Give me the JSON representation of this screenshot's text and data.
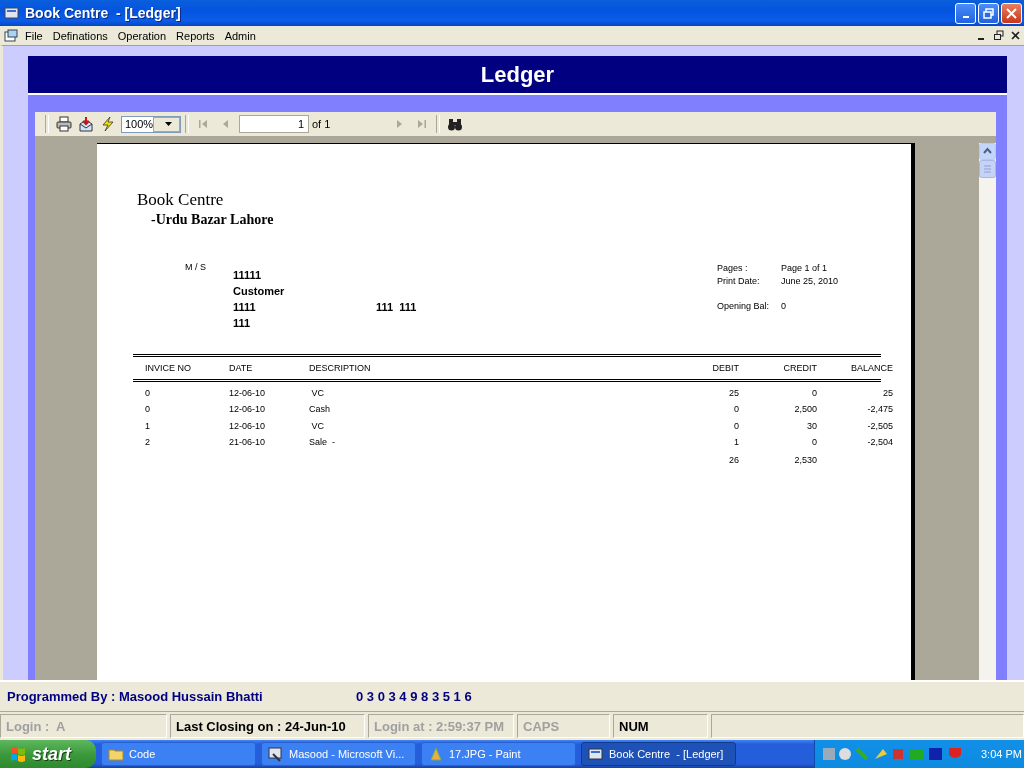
{
  "window": {
    "title": "Book Centre  - [Ledger]"
  },
  "menu": [
    "File",
    "Definations",
    "Operation",
    "Reports",
    "Admin"
  ],
  "report_header": "Ledger",
  "viewer": {
    "zoom": "100%",
    "page": "1",
    "page_of": "of 1",
    "nav_buttons": [
      {
        "kind": "first",
        "disabled": true
      },
      {
        "kind": "prev",
        "disabled": true
      },
      {
        "kind": "next",
        "disabled": true
      },
      {
        "kind": "last",
        "disabled": true
      }
    ]
  },
  "report": {
    "company": "Book Centre",
    "address": "-Urdu Bazar Lahore",
    "ms_label": "M / S",
    "customer": [
      "11111",
      "Customer",
      "1111",
      "111"
    ],
    "customer_extra": "111  111",
    "info": [
      {
        "label": "Pages :",
        "value": "Page 1 of 1"
      },
      {
        "label": "Print Date:",
        "value": "June 25, 2010"
      },
      {
        "label": "Opening Bal:",
        "value": "0"
      }
    ],
    "columns": [
      "INVICE NO",
      "DATE",
      "DESCRIPTION",
      "DEBIT",
      "CREDIT",
      "BALANCE"
    ],
    "rows": [
      [
        "0",
        "12-06-10",
        " VC",
        "25",
        "0",
        "25"
      ],
      [
        "0",
        "12-06-10",
        "Cash",
        "0",
        "2,500",
        "-2,475"
      ],
      [
        "1",
        "12-06-10",
        " VC",
        "0",
        "30",
        "-2,505"
      ],
      [
        "2",
        "21-06-10",
        "Sale  -",
        "1",
        "0",
        "-2,504"
      ]
    ],
    "totals": {
      "debit": "26",
      "credit": "2,530"
    }
  },
  "footer": {
    "programmer": "Programmed By : Masood Hussain Bhatti",
    "phone": "0 3 0 3 4 9 8 3 5 1 6"
  },
  "status_bar": [
    {
      "text": "Login :  A",
      "active": false
    },
    {
      "text": "Last Closing on : 24-Jun-10",
      "active": true
    },
    {
      "text": "Login at : 2:59:37 PM",
      "active": false
    },
    {
      "text": "CAPS",
      "active": false
    },
    {
      "text": "NUM",
      "active": true
    }
  ],
  "taskbar": {
    "start": "start",
    "tasks": [
      {
        "label": "Code",
        "selected": false
      },
      {
        "label": "Masood - Microsoft Vi...",
        "selected": false
      },
      {
        "label": "17.JPG - Paint",
        "selected": false
      },
      {
        "label": "Book Centre  - [Ledger]",
        "selected": true
      }
    ],
    "clock": "3:04 PM"
  }
}
